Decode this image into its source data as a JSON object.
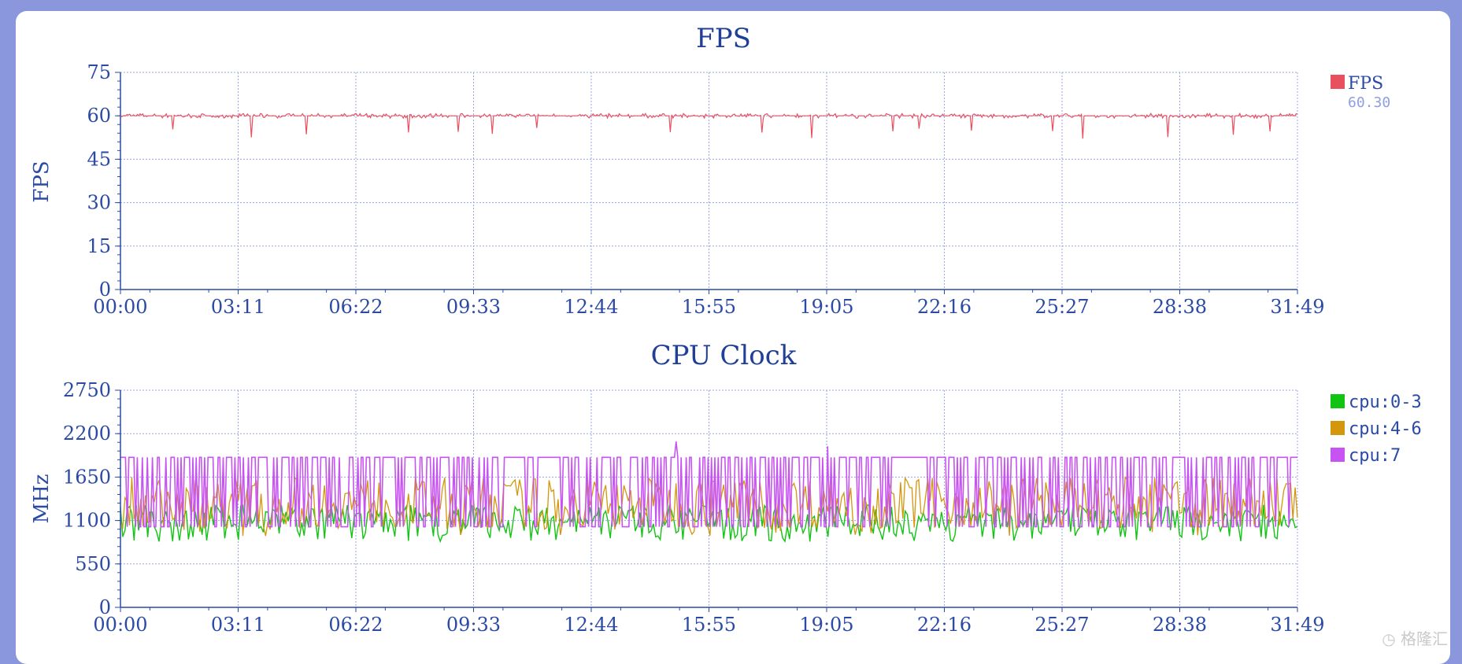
{
  "chart_data": [
    {
      "type": "line",
      "title": "FPS",
      "ylabel": "FPS",
      "xlabel": "",
      "ylim": [
        0,
        75
      ],
      "yticks": [
        "0",
        "15",
        "30",
        "45",
        "60",
        "75"
      ],
      "xticks": [
        "00:00",
        "03:11",
        "06:22",
        "09:33",
        "12:44",
        "15:55",
        "19:05",
        "22:16",
        "25:27",
        "28:38",
        "31:49"
      ],
      "x_unit": "mm:ss",
      "x_range_seconds": [
        0,
        1909
      ],
      "grid": true,
      "legend_position": "right",
      "series": [
        {
          "name": "FPS",
          "color": "#e8505f",
          "legend_value": "60.30",
          "baseline": 60,
          "min": 52
        }
      ]
    },
    {
      "type": "line",
      "title": "CPU Clock",
      "ylabel": "MHz",
      "xlabel": "",
      "ylim": [
        0,
        2750
      ],
      "yticks": [
        "0",
        "550",
        "1100",
        "1650",
        "2200",
        "2750"
      ],
      "xticks": [
        "00:00",
        "03:11",
        "06:22",
        "09:33",
        "12:44",
        "15:55",
        "19:05",
        "22:16",
        "25:27",
        "28:38",
        "31:49"
      ],
      "x_unit": "mm:ss",
      "x_range_seconds": [
        0,
        1909
      ],
      "grid": true,
      "legend_position": "right",
      "series": [
        {
          "name": "cpu:0-3",
          "color": "#11c411",
          "typical_low": 1000,
          "typical_high": 1300,
          "min": 830
        },
        {
          "name": "cpu:4-6",
          "color": "#d4960c",
          "typical_low": 1000,
          "typical_high": 1650,
          "min": 900
        },
        {
          "name": "cpu:7",
          "color": "#c753f2",
          "typical_low": 1020,
          "typical_high": 1900,
          "max": 2100
        }
      ]
    }
  ],
  "watermark": "格隆汇"
}
